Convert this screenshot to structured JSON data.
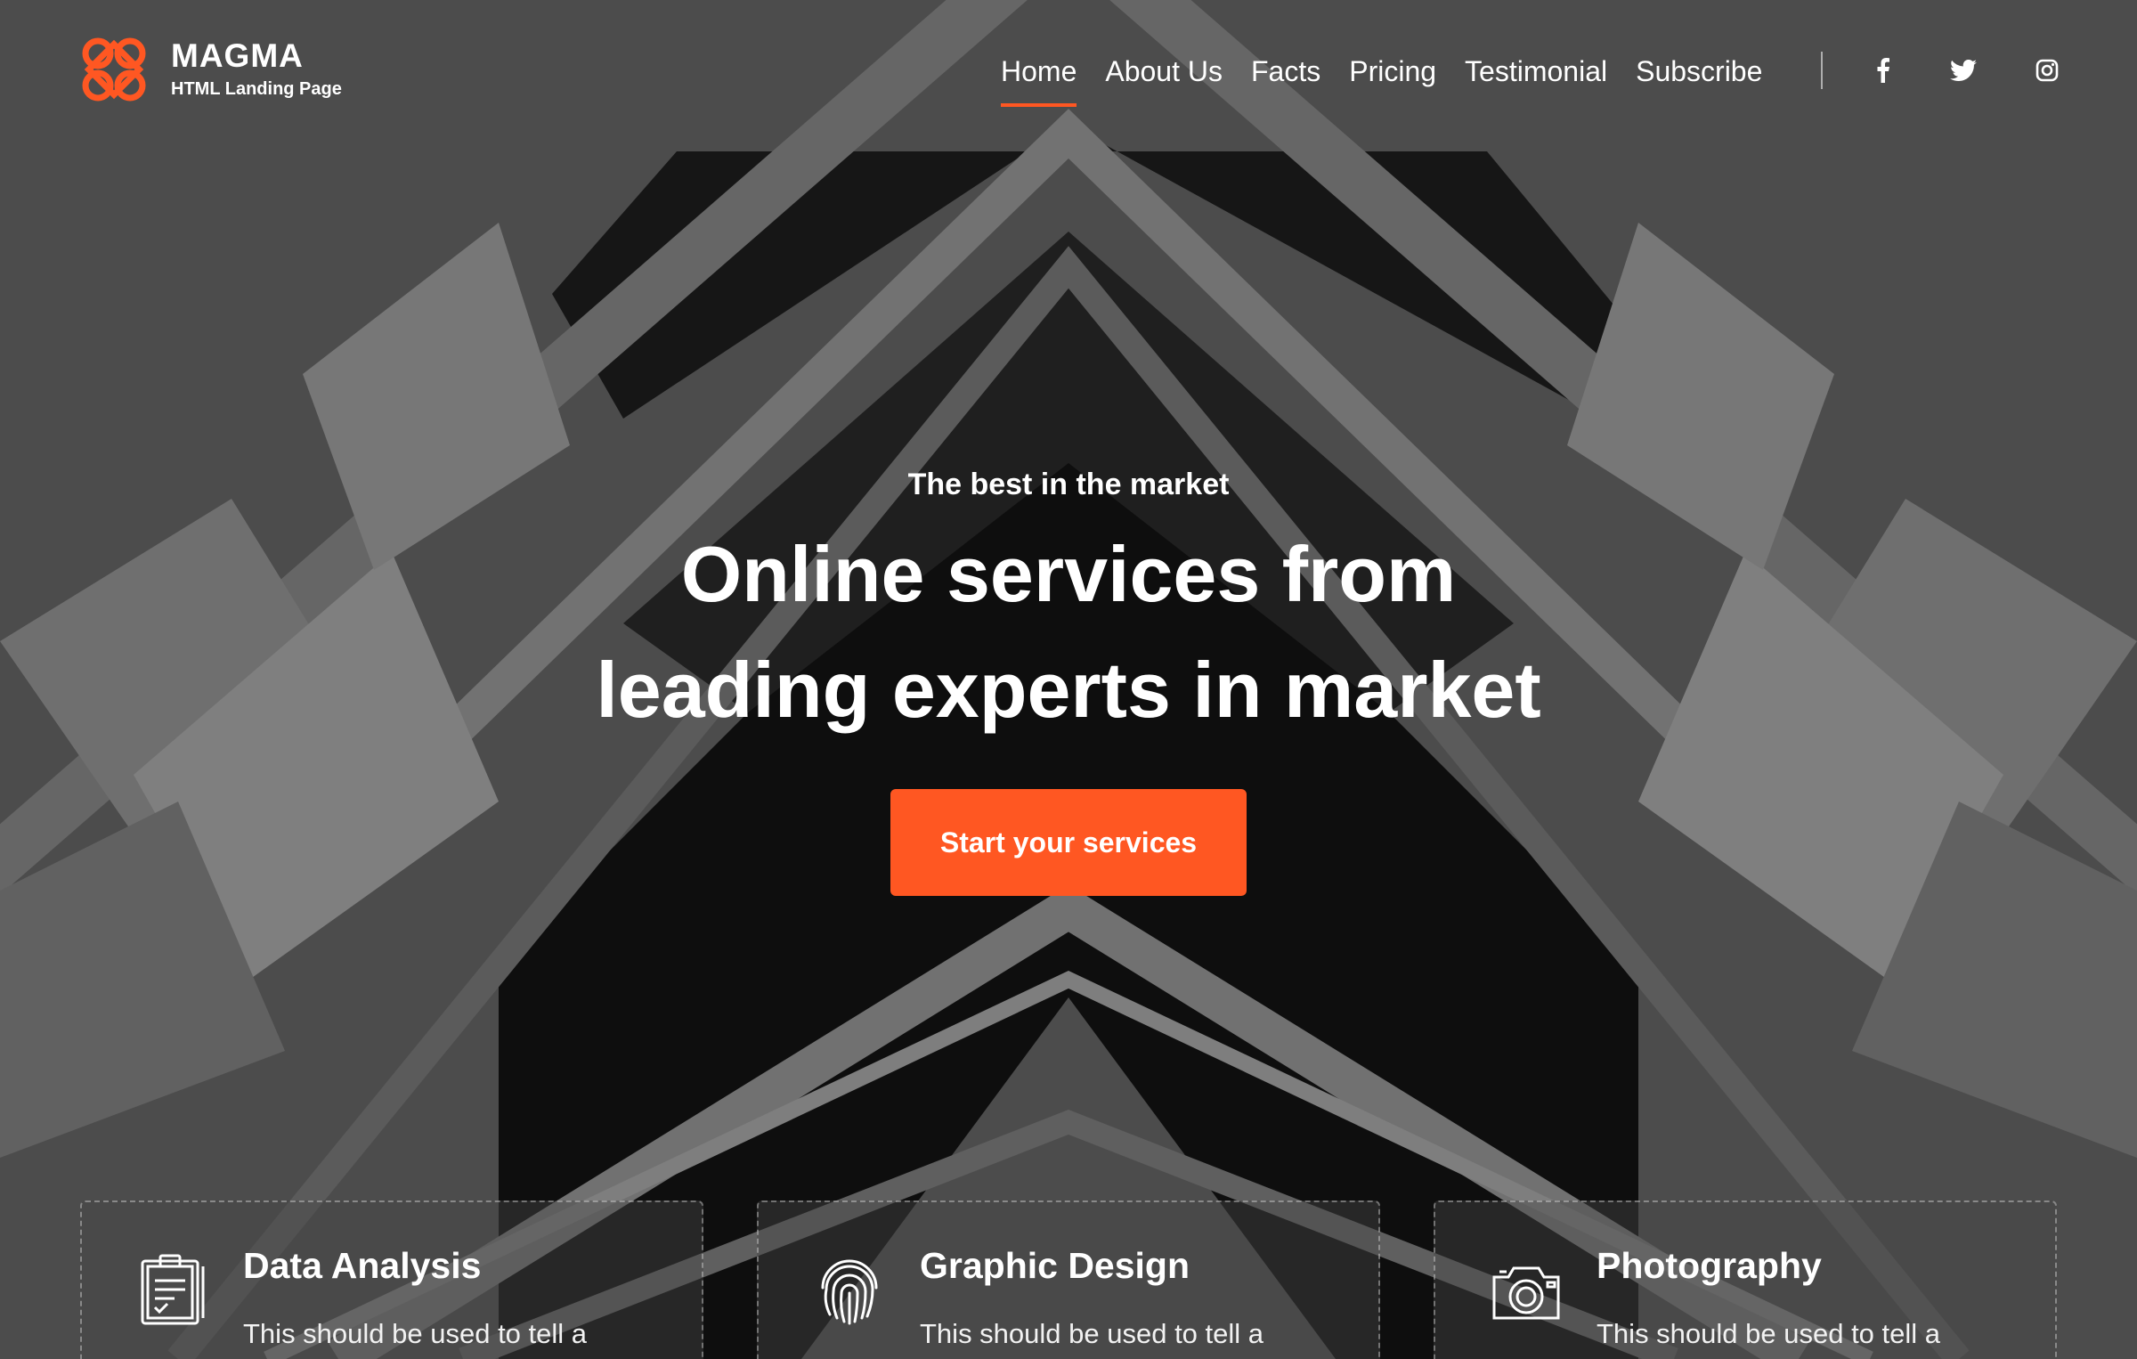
{
  "brand": {
    "name": "MAGMA",
    "tagline": "HTML Landing Page",
    "accent_color": "#ff5722"
  },
  "nav": {
    "items": [
      {
        "label": "Home",
        "active": true
      },
      {
        "label": "About Us",
        "active": false
      },
      {
        "label": "Facts",
        "active": false
      },
      {
        "label": "Pricing",
        "active": false
      },
      {
        "label": "Testimonial",
        "active": false
      },
      {
        "label": "Subscribe",
        "active": false
      }
    ],
    "social": [
      "facebook-icon",
      "twitter-icon",
      "instagram-icon"
    ]
  },
  "hero": {
    "subtitle": "The best in the market",
    "title_line1": "Online services from",
    "title_line2": "leading experts in market",
    "cta_label": "Start your services"
  },
  "services": [
    {
      "title": "Data Analysis",
      "text": "This should be used to tell a",
      "icon": "clipboard-icon"
    },
    {
      "title": "Graphic Design",
      "text": "This should be used to tell a",
      "icon": "fingerprint-icon"
    },
    {
      "title": "Photography",
      "text": "This should be used to tell a",
      "icon": "camera-icon"
    }
  ]
}
